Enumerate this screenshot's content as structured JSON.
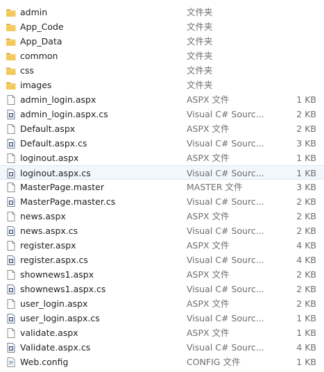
{
  "files": [
    {
      "name": "admin",
      "type": "文件夹",
      "size": "",
      "icon": "folder-icon"
    },
    {
      "name": "App_Code",
      "type": "文件夹",
      "size": "",
      "icon": "folder-icon"
    },
    {
      "name": "App_Data",
      "type": "文件夹",
      "size": "",
      "icon": "folder-icon"
    },
    {
      "name": "common",
      "type": "文件夹",
      "size": "",
      "icon": "folder-icon"
    },
    {
      "name": "css",
      "type": "文件夹",
      "size": "",
      "icon": "folder-icon"
    },
    {
      "name": "images",
      "type": "文件夹",
      "size": "",
      "icon": "folder-icon"
    },
    {
      "name": "admin_login.aspx",
      "type": "ASPX 文件",
      "size": "1 KB",
      "icon": "document-icon"
    },
    {
      "name": "admin_login.aspx.cs",
      "type": "Visual C# Sourc...",
      "size": "2 KB",
      "icon": "csharp-source-icon"
    },
    {
      "name": "Default.aspx",
      "type": "ASPX 文件",
      "size": "2 KB",
      "icon": "document-icon"
    },
    {
      "name": "Default.aspx.cs",
      "type": "Visual C# Sourc...",
      "size": "3 KB",
      "icon": "csharp-source-icon"
    },
    {
      "name": "loginout.aspx",
      "type": "ASPX 文件",
      "size": "1 KB",
      "icon": "document-icon"
    },
    {
      "name": "loginout.aspx.cs",
      "type": "Visual C# Sourc...",
      "size": "1 KB",
      "icon": "csharp-source-icon",
      "selected": true
    },
    {
      "name": "MasterPage.master",
      "type": "MASTER 文件",
      "size": "3 KB",
      "icon": "document-icon"
    },
    {
      "name": "MasterPage.master.cs",
      "type": "Visual C# Sourc...",
      "size": "2 KB",
      "icon": "csharp-source-icon"
    },
    {
      "name": "news.aspx",
      "type": "ASPX 文件",
      "size": "2 KB",
      "icon": "document-icon"
    },
    {
      "name": "news.aspx.cs",
      "type": "Visual C# Sourc...",
      "size": "2 KB",
      "icon": "csharp-source-icon"
    },
    {
      "name": "register.aspx",
      "type": "ASPX 文件",
      "size": "4 KB",
      "icon": "document-icon"
    },
    {
      "name": "register.aspx.cs",
      "type": "Visual C# Sourc...",
      "size": "4 KB",
      "icon": "csharp-source-icon"
    },
    {
      "name": "shownews1.aspx",
      "type": "ASPX 文件",
      "size": "2 KB",
      "icon": "document-icon"
    },
    {
      "name": "shownews1.aspx.cs",
      "type": "Visual C# Sourc...",
      "size": "2 KB",
      "icon": "csharp-source-icon"
    },
    {
      "name": "user_login.aspx",
      "type": "ASPX 文件",
      "size": "2 KB",
      "icon": "document-icon"
    },
    {
      "name": "user_login.aspx.cs",
      "type": "Visual C# Sourc...",
      "size": "1 KB",
      "icon": "csharp-source-icon"
    },
    {
      "name": "validate.aspx",
      "type": "ASPX 文件",
      "size": "1 KB",
      "icon": "document-icon"
    },
    {
      "name": "Validate.aspx.cs",
      "type": "Visual C# Sourc...",
      "size": "4 KB",
      "icon": "csharp-source-icon"
    },
    {
      "name": "Web.config",
      "type": "CONFIG 文件",
      "size": "1 KB",
      "icon": "config-file-icon"
    }
  ],
  "colors": {
    "folder": "#e8b948",
    "selection": "#f2f7fc",
    "secondary_text": "#6d6d6d"
  }
}
